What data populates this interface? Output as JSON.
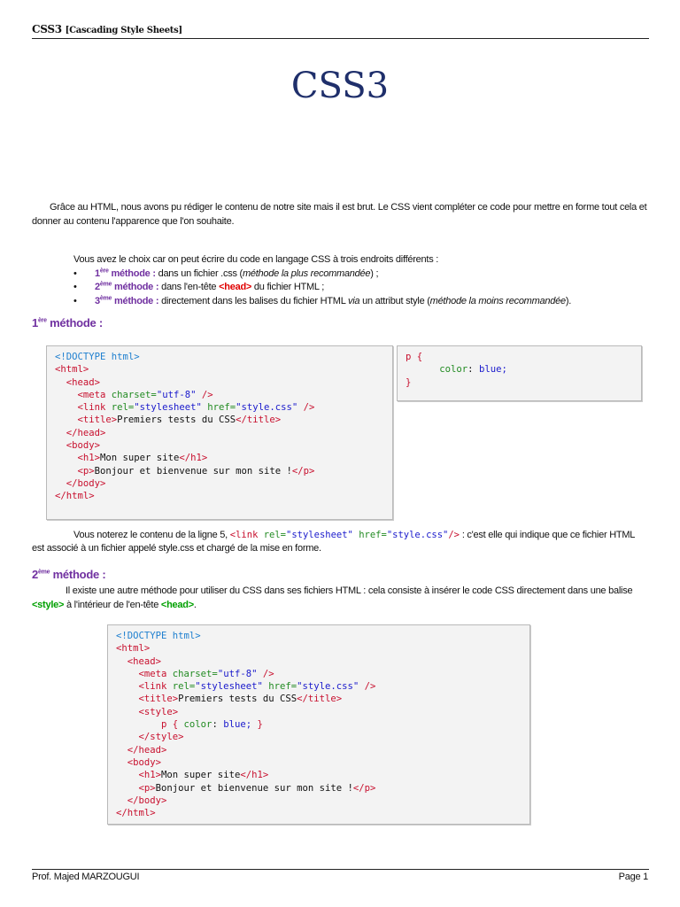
{
  "header": {
    "title": "CSS3",
    "subtitle": "[Cascading Style Sheets]"
  },
  "doc_title": "CSS3",
  "intro": "Grâce au HTML, nous avons pu rédiger le contenu de notre site mais il est brut. Le CSS vient compléter ce code pour mettre en forme tout cela et donner au contenu l'apparence que l'on souhaite.",
  "choice": {
    "lead": "Vous avez le choix car on peut écrire du code en langage CSS à trois endroits différents :",
    "items": [
      {
        "num": "1",
        "sup": "ère",
        "label": " méthode :",
        "text1": " dans un fichier .css (",
        "ital": "méthode la plus recommandée",
        "text2": ") ;"
      },
      {
        "num": "2",
        "sup": "ème",
        "label": " méthode :",
        "text1": " dans l'en-tête ",
        "tag": "<head>",
        "text2": " du fichier HTML ;"
      },
      {
        "num": "3",
        "sup": "ème",
        "label": " méthode :",
        "text1": " directement dans les balises du fichier HTML ",
        "ital1": "via",
        "text2": " un attribut style (",
        "ital2": "méthode la moins recommandée",
        "text3": ")."
      }
    ]
  },
  "m1": {
    "num": "1",
    "sup": "ère",
    "label": " méthode :"
  },
  "code1": [
    [
      [
        "<!DOCTYPE html>",
        "doc"
      ]
    ],
    [
      [
        "<html>",
        "tag"
      ]
    ],
    [
      [
        "  <head>",
        "tag"
      ]
    ],
    [
      [
        "    <meta ",
        "tag"
      ],
      [
        "charset=",
        "attr"
      ],
      [
        "\"utf-8\"",
        "val"
      ],
      [
        " />",
        "tag"
      ]
    ],
    [
      [
        "    <link ",
        "tag"
      ],
      [
        "rel=",
        "attr"
      ],
      [
        "\"stylesheet\"",
        "val"
      ],
      [
        " href=",
        "attr"
      ],
      [
        "\"style.css\"",
        "val"
      ],
      [
        " />",
        "tag"
      ]
    ],
    [
      [
        "    <title>",
        "tag"
      ],
      [
        "Premiers tests du CSS",
        "txt"
      ],
      [
        "</title>",
        "tag"
      ]
    ],
    [
      [
        "  </head>",
        "tag"
      ]
    ],
    [
      [
        "  <body>",
        "tag"
      ]
    ],
    [
      [
        "    <h1>",
        "tag"
      ],
      [
        "Mon super site",
        "txt"
      ],
      [
        "</h1>",
        "tag"
      ]
    ],
    [
      [
        "    <p>",
        "tag"
      ],
      [
        "Bonjour et bienvenue sur mon site !",
        "txt"
      ],
      [
        "</p>",
        "tag"
      ]
    ],
    [
      [
        "  </body>",
        "tag"
      ]
    ],
    [
      [
        "</html>",
        "tag"
      ]
    ]
  ],
  "code2": [
    [
      [
        "p {",
        "tag"
      ]
    ],
    [
      [
        "      color",
        "attr"
      ],
      [
        ": ",
        "txt"
      ],
      [
        "blue;",
        "val"
      ]
    ],
    [
      [
        "}",
        "tag"
      ]
    ]
  ],
  "note": {
    "pre": "Vous noterez le contenu de la ligne 5, ",
    "c1": "<link ",
    "c2": "rel=",
    "c3": "\"stylesheet\"",
    "c4": " href=",
    "c5": "\"style.css\"",
    "c6": "/>",
    "post": " : c'est elle qui indique que ce fichier HTML est associé à un fichier appelé style.css et chargé de la mise en forme."
  },
  "m2": {
    "num": "2",
    "sup": "ème",
    "label": " méthode :"
  },
  "m2text": {
    "pre": "Il existe une autre méthode pour utiliser du CSS dans ses fichiers HTML : cela consiste à insérer le code CSS directement dans une balise ",
    "tag1": "<style>",
    "mid": " à l'intérieur de l'en-tête ",
    "tag2": "<head>",
    "post": "."
  },
  "code3": [
    [
      [
        "<!DOCTYPE html>",
        "doc"
      ]
    ],
    [
      [
        "<html>",
        "tag"
      ]
    ],
    [
      [
        "  <head>",
        "tag"
      ]
    ],
    [
      [
        "    <meta ",
        "tag"
      ],
      [
        "charset=",
        "attr"
      ],
      [
        "\"utf-8\"",
        "val"
      ],
      [
        " />",
        "tag"
      ]
    ],
    [
      [
        "    <link ",
        "tag"
      ],
      [
        "rel=",
        "attr"
      ],
      [
        "\"stylesheet\"",
        "val"
      ],
      [
        " href=",
        "attr"
      ],
      [
        "\"style.css\"",
        "val"
      ],
      [
        " />",
        "tag"
      ]
    ],
    [
      [
        "    <title>",
        "tag"
      ],
      [
        "Premiers tests du CSS",
        "txt"
      ],
      [
        "</title>",
        "tag"
      ]
    ],
    [
      [
        "    <style>",
        "tag"
      ]
    ],
    [
      [
        "        p { ",
        "tag"
      ],
      [
        "color",
        "attr"
      ],
      [
        ": ",
        "txt"
      ],
      [
        "blue; ",
        "val"
      ],
      [
        "}",
        "tag"
      ]
    ],
    [
      [
        "    </style>",
        "tag"
      ]
    ],
    [
      [
        "  </head>",
        "tag"
      ]
    ],
    [
      [
        "  <body>",
        "tag"
      ]
    ],
    [
      [
        "    <h1>",
        "tag"
      ],
      [
        "Mon super site",
        "txt"
      ],
      [
        "</h1>",
        "tag"
      ]
    ],
    [
      [
        "    <p>",
        "tag"
      ],
      [
        "Bonjour et bienvenue sur mon site !",
        "txt"
      ],
      [
        "</p>",
        "tag"
      ]
    ],
    [
      [
        "  </body>",
        "tag"
      ]
    ],
    [
      [
        "</html>",
        "tag"
      ]
    ]
  ],
  "footer": {
    "author": "Prof. Majed MARZOUGUI",
    "page": "Page 1"
  }
}
